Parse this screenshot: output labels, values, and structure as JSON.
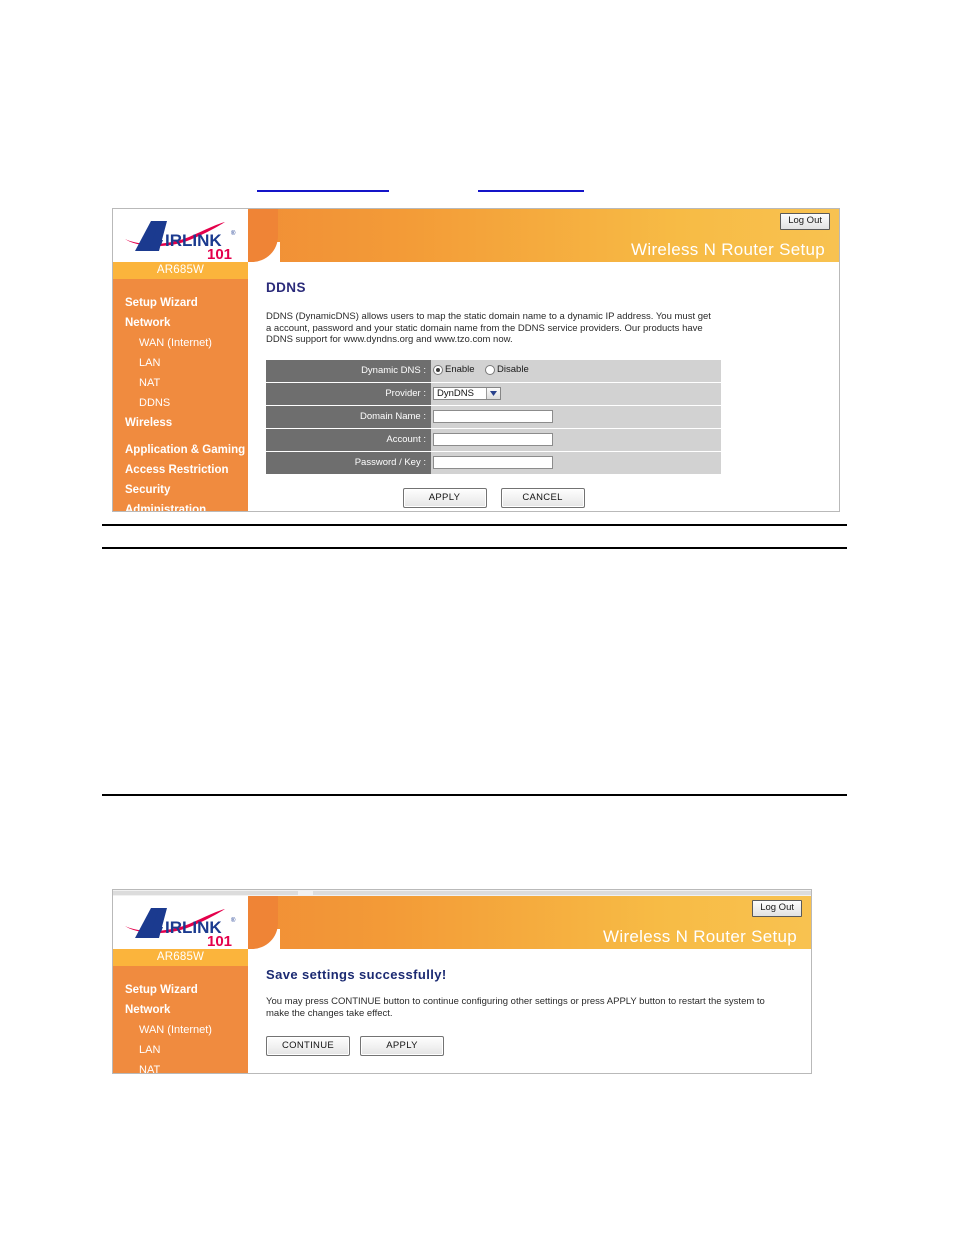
{
  "document": {
    "rules": [
      {
        "name": "blue-rule-left"
      },
      {
        "name": "blue-rule-right"
      },
      {
        "name": "page-rule-1"
      },
      {
        "name": "page-rule-2"
      },
      {
        "name": "page-rule-3"
      }
    ]
  },
  "panel1": {
    "header": {
      "logo_alt": "AIRLINK 101",
      "logo_word": "IRLINK",
      "logo_initial": "A",
      "logo_sub": "101",
      "logo_trademark": "®",
      "logout_label": "Log Out",
      "title": "Wireless N Router Setup"
    },
    "sidebar": {
      "model": "AR685W",
      "items": [
        {
          "label": "Setup Wizard",
          "level": "top"
        },
        {
          "label": "Network",
          "level": "top"
        },
        {
          "label": "WAN (Internet)",
          "level": "sub"
        },
        {
          "label": "LAN",
          "level": "sub"
        },
        {
          "label": "NAT",
          "level": "sub"
        },
        {
          "label": "DDNS",
          "level": "sub"
        },
        {
          "label": "Wireless",
          "level": "top"
        },
        {
          "label": "Application & Gaming",
          "level": "top-spaced"
        },
        {
          "label": "Access Restriction",
          "level": "top"
        },
        {
          "label": "Security",
          "level": "top"
        },
        {
          "label": "Administration",
          "level": "top"
        }
      ]
    },
    "content": {
      "title": "DDNS",
      "description": "DDNS (DynamicDNS) allows users to map the static domain name to a dynamic IP address. You must get a account, password and your static domain name from the DDNS service providers. Our products have DDNS support for www.dyndns.org and www.tzo.com now.",
      "form": {
        "rows": [
          {
            "label": "Dynamic DNS :",
            "type": "radio",
            "options": [
              {
                "label": "Enable",
                "checked": true
              },
              {
                "label": "Disable",
                "checked": false
              }
            ]
          },
          {
            "label": "Provider :",
            "type": "select",
            "value": "DynDNS"
          },
          {
            "label": "Domain Name :",
            "type": "text",
            "value": ""
          },
          {
            "label": "Account :",
            "type": "text",
            "value": ""
          },
          {
            "label": "Password / Key :",
            "type": "text",
            "value": ""
          }
        ]
      },
      "buttons": [
        {
          "label": "APPLY"
        },
        {
          "label": "CANCEL"
        }
      ]
    }
  },
  "panel2": {
    "header": {
      "logo_word": "IRLINK",
      "logo_initial": "A",
      "logo_sub": "101",
      "logo_trademark": "®",
      "logout_label": "Log Out",
      "title": "Wireless N Router Setup"
    },
    "sidebar": {
      "model": "AR685W",
      "items": [
        {
          "label": "Setup Wizard",
          "level": "top"
        },
        {
          "label": "Network",
          "level": "top"
        },
        {
          "label": "WAN (Internet)",
          "level": "sub"
        },
        {
          "label": "LAN",
          "level": "sub"
        },
        {
          "label": "NAT",
          "level": "sub"
        }
      ]
    },
    "content": {
      "title": "Save settings successfully!",
      "description": "You may press CONTINUE button to continue configuring other settings or press APPLY button to restart the system to make the changes take effect.",
      "buttons": [
        {
          "label": "CONTINUE"
        },
        {
          "label": "APPLY"
        }
      ]
    }
  },
  "colors": {
    "orange_dark": "#ef8436",
    "orange_sidebar": "#f08b3f",
    "amber_band": "#fbb43c",
    "header_right": "#f8c250",
    "label_grey": "#6e6e6e",
    "value_grey": "#d2d2d2",
    "title_navy": "#2b2b7a",
    "logo_blue": "#1b3a8f",
    "logo_red": "#e4004b"
  }
}
